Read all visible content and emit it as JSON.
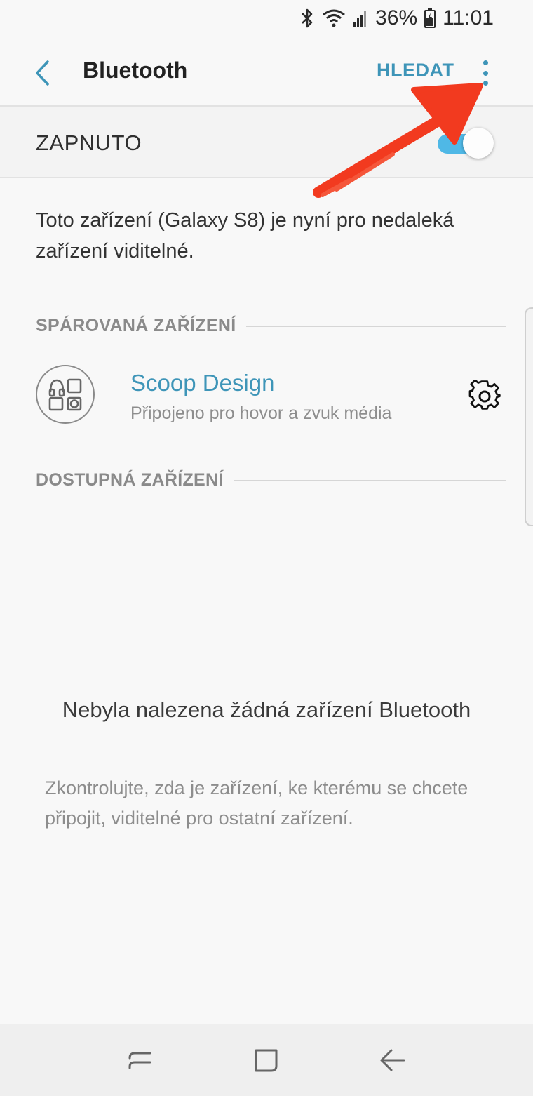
{
  "status_bar": {
    "battery": "36%",
    "time": "11:01",
    "icons": [
      "bluetooth-icon",
      "wifi-icon",
      "signal-icon",
      "battery-icon"
    ]
  },
  "app_bar": {
    "title": "Bluetooth",
    "search_label": "HLEDAT",
    "back_icon": "chevron-left-icon",
    "more_icon": "more-vert-icon"
  },
  "switch": {
    "label": "ZAPNUTO",
    "state": "on"
  },
  "visibility_text": "Toto zařízení (Galaxy S8) je nyní pro nedaleká zařízení viditelné.",
  "paired": {
    "header": "SPÁROVANÁ ZAŘÍZENÍ",
    "devices": [
      {
        "name": "Scoop Design",
        "status": "Připojeno pro hovor a zvuk média",
        "icon": "headset-multimedia-icon"
      }
    ]
  },
  "available": {
    "header": "DOSTUPNÁ ZAŘÍZENÍ",
    "empty_title": "Nebyla nalezena žádná zařízení Bluetooth",
    "empty_hint": "Zkontrolujte, zda je zařízení, ke kterému se chcete připojit, viditelné pro ostatní zařízení."
  },
  "colors": {
    "accent": "#3e95b8",
    "toggle_track": "#4fb8e6",
    "annotation": "#f23a1f"
  }
}
